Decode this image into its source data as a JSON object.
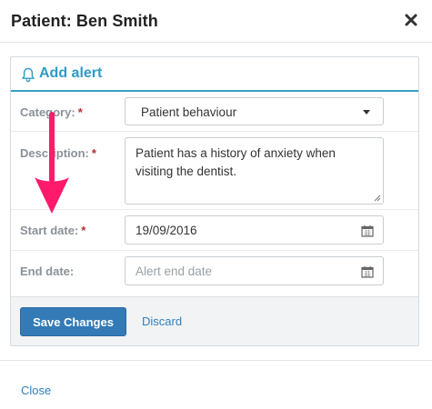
{
  "modal": {
    "title": "Patient: Ben Smith",
    "close_icon": "close-x-icon"
  },
  "panel": {
    "title": "Add alert",
    "icon": "bell-icon",
    "accent_color": "#35a0c4"
  },
  "form": {
    "category": {
      "label": "Category:",
      "required_mark": "*",
      "value": "Patient behaviour"
    },
    "description": {
      "label": "Description:",
      "required_mark": "*",
      "value": "Patient has a history of anxiety when visiting the dentist."
    },
    "start_date": {
      "label": "Start date:",
      "required_mark": "*",
      "value": "19/09/2016"
    },
    "end_date": {
      "label": "End date:",
      "value": "",
      "placeholder": "Alert end date"
    }
  },
  "actions": {
    "save_label": "Save Changes",
    "discard_label": "Discard",
    "primary_color": "#337ab7"
  },
  "footer": {
    "close_label": "Close"
  },
  "annotation": {
    "arrow_color": "#ff1a6b"
  }
}
